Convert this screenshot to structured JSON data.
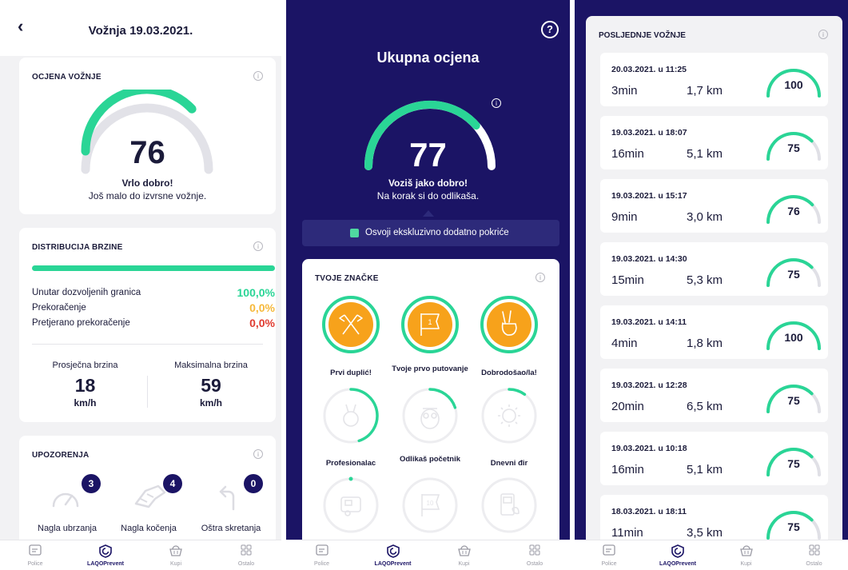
{
  "screen1": {
    "title": "Vožnja 19.03.2021.",
    "back_glyph": "‹",
    "rating_card": {
      "title": "OCJENA VOŽNJE",
      "score": "76",
      "score_fraction": 0.76,
      "label": "Vrlo dobro!",
      "sub": "Još malo do izvrsne vožnje."
    },
    "distribution_card": {
      "title": "DISTRIBUCIJA BRZINE",
      "rows": [
        {
          "label": "Unutar dozvoljenih granica",
          "value": "100,0%",
          "color": "#2ad596"
        },
        {
          "label": "Prekoračenje",
          "value": "0,0%",
          "color": "#f6b93b"
        },
        {
          "label": "Pretjerano prekoračenje",
          "value": "0,0%",
          "color": "#e03c31"
        }
      ],
      "avg_label": "Prosječna brzina",
      "avg_value": "18",
      "avg_unit": "km/h",
      "max_label": "Maksimalna brzina",
      "max_value": "59",
      "max_unit": "km/h"
    },
    "warnings_card": {
      "title": "UPOZORENJA",
      "items": [
        {
          "label": "Nagla ubrzanja",
          "count": "3",
          "icon": "speedometer-icon"
        },
        {
          "label": "Nagla kočenja",
          "count": "4",
          "icon": "brake-icon"
        },
        {
          "label": "Oštra skretanja",
          "count": "0",
          "icon": "turn-left-icon"
        }
      ]
    }
  },
  "screen2": {
    "help_glyph": "?",
    "title": "Ukupna ocjena",
    "score": "77",
    "score_fraction": 0.77,
    "label": "Voziš jako dobro!",
    "sub": "Na korak si do odlikaša.",
    "promo": "Osvoji ekskluzivno dodatno pokriće",
    "badges_title": "TVOJE ZNAČKE",
    "badges": [
      {
        "name": "Prvi duplić!",
        "earned": true,
        "progress": 1.0,
        "icon": "crossed-flags-icon"
      },
      {
        "name": "Tvoje prvo putovanje",
        "earned": true,
        "progress": 1.0,
        "icon": "flag-icon"
      },
      {
        "name": "Dobrodošao/la!",
        "earned": true,
        "progress": 1.0,
        "icon": "victory-hand-icon"
      },
      {
        "name": "Profesionalac",
        "earned": false,
        "progress": 0.45,
        "icon": "medal-icon"
      },
      {
        "name": "Odlikaš početnik",
        "earned": false,
        "progress": 0.2,
        "icon": "owl-icon"
      },
      {
        "name": "Dnevni đir",
        "earned": false,
        "progress": 0.1,
        "icon": "sun-icon"
      },
      {
        "name": "",
        "earned": false,
        "progress": 0.0,
        "icon": "caravan-icon"
      },
      {
        "name": "",
        "earned": false,
        "progress": 0.0,
        "icon": "flag-ten-icon"
      },
      {
        "name": "",
        "earned": false,
        "progress": 0.0,
        "icon": "fuel-leaf-icon"
      }
    ]
  },
  "screen3": {
    "title": "POSLJEDNJE VOŽNJE",
    "trips": [
      {
        "date": "20.03.2021. u 11:25",
        "duration": "3min",
        "distance": "1,7 km",
        "score": "100"
      },
      {
        "date": "19.03.2021. u 18:07",
        "duration": "16min",
        "distance": "5,1 km",
        "score": "75"
      },
      {
        "date": "19.03.2021. u 15:17",
        "duration": "9min",
        "distance": "3,0 km",
        "score": "76"
      },
      {
        "date": "19.03.2021. u 14:30",
        "duration": "15min",
        "distance": "5,3 km",
        "score": "75"
      },
      {
        "date": "19.03.2021. u 14:11",
        "duration": "4min",
        "distance": "1,8 km",
        "score": "100"
      },
      {
        "date": "19.03.2021. u 12:28",
        "duration": "20min",
        "distance": "6,5 km",
        "score": "75"
      },
      {
        "date": "19.03.2021. u 10:18",
        "duration": "16min",
        "distance": "5,1 km",
        "score": "75"
      },
      {
        "date": "18.03.2021. u 18:11",
        "duration": "11min",
        "distance": "3,5 km",
        "score": "75"
      }
    ]
  },
  "tabbar": [
    {
      "label": "Police",
      "icon": "policy-card-icon",
      "active": false
    },
    {
      "label": "LAQOPrevent",
      "icon": "shield-icon",
      "active": true
    },
    {
      "label": "Kupi",
      "icon": "basket-icon",
      "active": false
    },
    {
      "label": "Ostalo",
      "icon": "grid-icon",
      "active": false
    }
  ],
  "colors": {
    "accent_green": "#2ad596",
    "navy": "#1b1465",
    "orange": "#f7a21b",
    "track_gray": "#e0e0e6"
  },
  "info_glyph": "i"
}
